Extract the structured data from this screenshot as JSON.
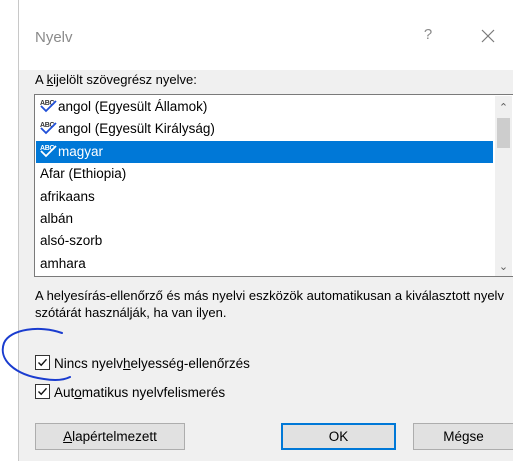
{
  "dialog": {
    "title": "Nyelv",
    "help_symbol": "?",
    "list_label_parts": [
      "A ",
      "k",
      "ijelölt szövegrész nyelve:"
    ],
    "languages": [
      {
        "label": "angol (Egyesült Államok)",
        "spell_icon": true,
        "selected": false
      },
      {
        "label": "angol (Egyesült Királyság)",
        "spell_icon": true,
        "selected": false
      },
      {
        "label": "magyar",
        "spell_icon": true,
        "selected": true
      },
      {
        "label": "Afar (Ethiopia)",
        "spell_icon": false,
        "selected": false
      },
      {
        "label": "afrikaans",
        "spell_icon": false,
        "selected": false
      },
      {
        "label": "albán",
        "spell_icon": false,
        "selected": false
      },
      {
        "label": "alsó-szorb",
        "spell_icon": false,
        "selected": false
      },
      {
        "label": "amhara",
        "spell_icon": false,
        "selected": false
      }
    ],
    "spell_icon_text": "ABC",
    "info_text": "A helyesírás-ellenőrző és más nyelvi eszközök automatikusan a kiválasztott nyelv szótárát használják, ha van ilyen.",
    "checkbox_no_proofing": {
      "parts": [
        "Nincs nyelv",
        "h",
        "elyesség-ellenőrzés"
      ],
      "checked": true
    },
    "checkbox_auto_detect": {
      "parts": [
        "Aut",
        "o",
        "matikus nyelvfelismerés"
      ],
      "checked": true
    },
    "buttons": {
      "set_default_parts": [
        "",
        "A",
        "lapértelmezett"
      ],
      "ok": "OK",
      "cancel": "Mégse"
    },
    "colors": {
      "selection": "#0078d7",
      "dialog_bg": "#f0f0f0",
      "annotation_ink": "#1a3ccf"
    }
  }
}
